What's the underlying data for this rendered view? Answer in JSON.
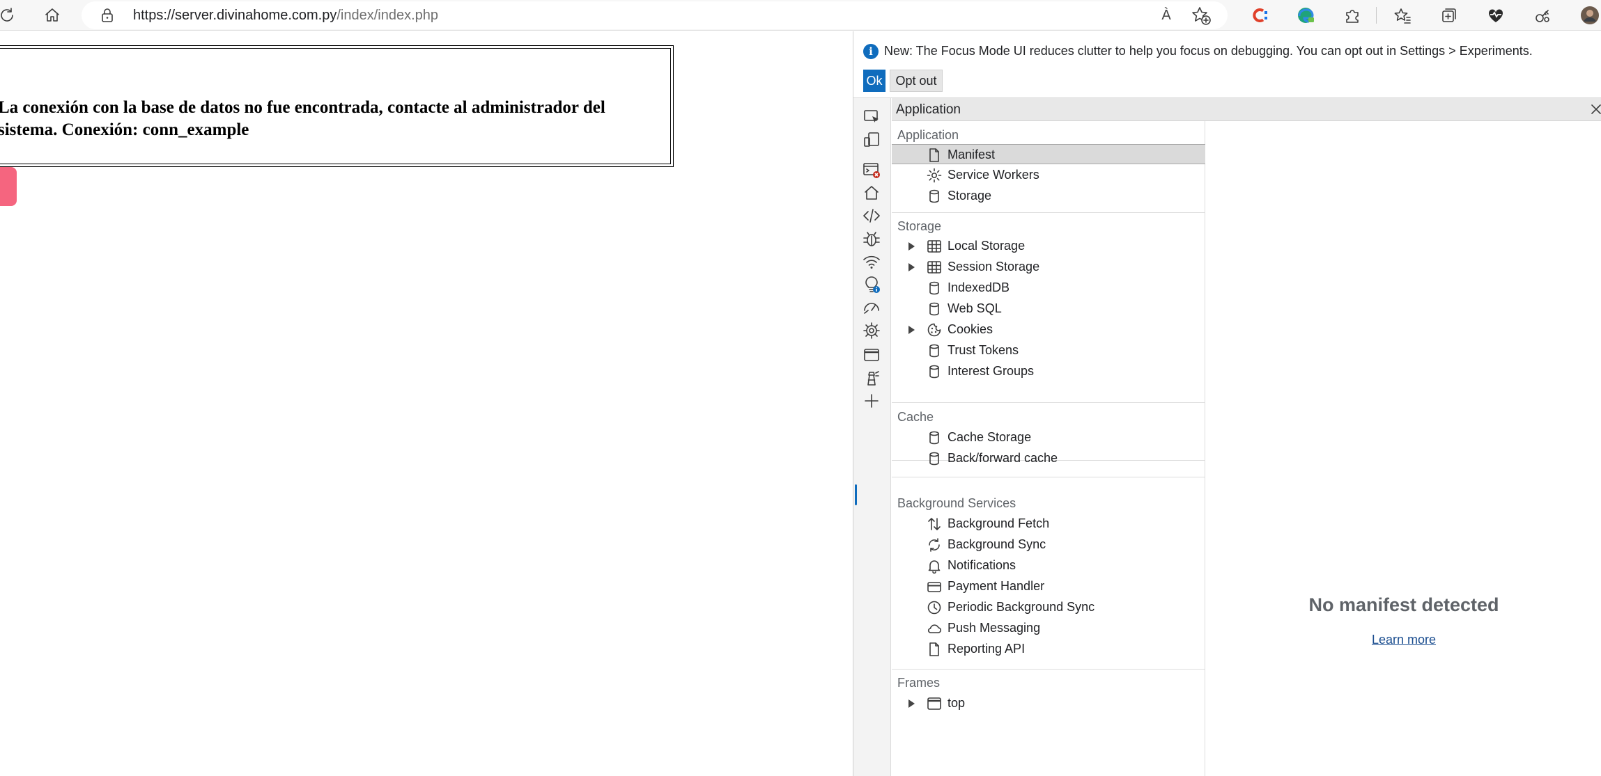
{
  "browser": {
    "url_host": "https://server.divinahome.com.py",
    "url_path": "/index/index.php",
    "read_aloud_glyph": "À"
  },
  "page": {
    "error_message": "La conexión con la base de datos no fue encontrada, contacte al administrador del sistema. Conexión: conn_example"
  },
  "devtools": {
    "notice": {
      "icon": "i",
      "text": "New: The Focus Mode UI reduces clutter to help you focus on debugging. You can opt out in Settings > Experiments.",
      "ok_label": "Ok",
      "optout_label": "Opt out"
    },
    "panel_title": "Application",
    "sections": {
      "application": "Application",
      "storage": "Storage",
      "cache": "Cache",
      "background": "Background Services",
      "frames": "Frames"
    },
    "items": {
      "manifest": "Manifest",
      "service_workers": "Service Workers",
      "storage": "Storage",
      "local_storage": "Local Storage",
      "session_storage": "Session Storage",
      "indexeddb": "IndexedDB",
      "web_sql": "Web SQL",
      "cookies": "Cookies",
      "trust_tokens": "Trust Tokens",
      "interest_groups": "Interest Groups",
      "cache_storage": "Cache Storage",
      "bf_cache": "Back/forward cache",
      "bg_fetch": "Background Fetch",
      "bg_sync": "Background Sync",
      "notifications": "Notifications",
      "payment_handler": "Payment Handler",
      "periodic_sync": "Periodic Background Sync",
      "push_messaging": "Push Messaging",
      "reporting_api": "Reporting API",
      "top": "top"
    },
    "details": {
      "heading": "No manifest detected",
      "link": "Learn more"
    }
  },
  "colors": {
    "accent": "#0f6cbd",
    "pink_button": "#f5657f",
    "selection": "#dadada"
  }
}
